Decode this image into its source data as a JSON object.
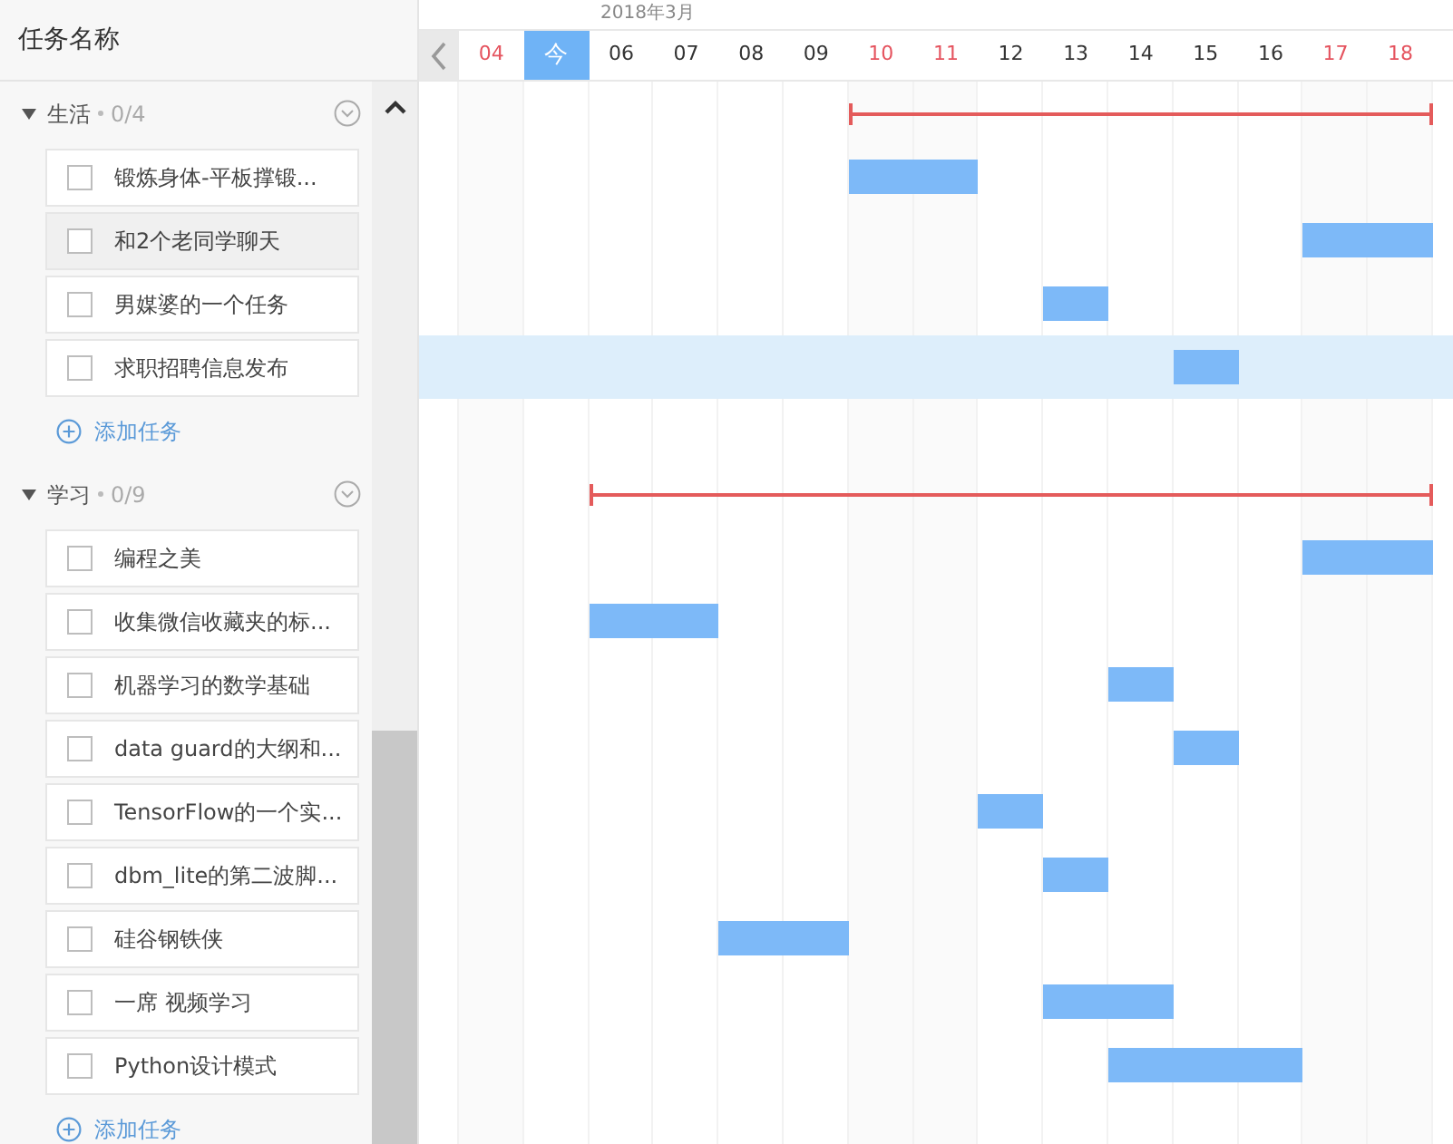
{
  "header": {
    "title": "任务名称"
  },
  "month": "2018年3月",
  "days": [
    {
      "label": "04",
      "weekend": true,
      "today": false
    },
    {
      "label": "今",
      "weekend": false,
      "today": true
    },
    {
      "label": "06",
      "weekend": false,
      "today": false
    },
    {
      "label": "07",
      "weekend": false,
      "today": false
    },
    {
      "label": "08",
      "weekend": false,
      "today": false
    },
    {
      "label": "09",
      "weekend": false,
      "today": false
    },
    {
      "label": "10",
      "weekend": true,
      "today": false
    },
    {
      "label": "11",
      "weekend": true,
      "today": false
    },
    {
      "label": "12",
      "weekend": false,
      "today": false
    },
    {
      "label": "13",
      "weekend": false,
      "today": false
    },
    {
      "label": "14",
      "weekend": false,
      "today": false
    },
    {
      "label": "15",
      "weekend": false,
      "today": false
    },
    {
      "label": "16",
      "weekend": false,
      "today": false
    },
    {
      "label": "17",
      "weekend": true,
      "today": false
    },
    {
      "label": "18",
      "weekend": true,
      "today": false
    }
  ],
  "groups": [
    {
      "name": "生活",
      "count": "0/4",
      "expanded": true,
      "span_days": [
        false,
        false,
        false,
        false,
        false,
        false,
        true,
        true,
        true,
        true,
        true,
        true,
        true,
        true,
        true
      ],
      "add_label": "添加任务",
      "tasks": [
        {
          "name": "锻炼身体-平板撑锻...",
          "checked": false,
          "hovered": false,
          "selected": false,
          "bar_days": [
            false,
            false,
            false,
            false,
            false,
            false,
            true,
            true,
            false,
            false,
            false,
            false,
            false,
            false,
            false
          ]
        },
        {
          "name": "和2个老同学聊天",
          "checked": false,
          "hovered": true,
          "selected": false,
          "bar_days": [
            false,
            false,
            false,
            false,
            false,
            false,
            false,
            false,
            false,
            false,
            false,
            false,
            false,
            true,
            true
          ]
        },
        {
          "name": "男媒婆的一个任务",
          "checked": false,
          "hovered": false,
          "selected": false,
          "bar_days": [
            false,
            false,
            false,
            false,
            false,
            false,
            false,
            false,
            false,
            true,
            false,
            false,
            false,
            false,
            false
          ]
        },
        {
          "name": "求职招聘信息发布",
          "checked": false,
          "hovered": false,
          "selected": true,
          "bar_days": [
            false,
            false,
            false,
            false,
            false,
            false,
            false,
            false,
            false,
            false,
            false,
            true,
            false,
            false,
            false
          ]
        }
      ]
    },
    {
      "name": "学习",
      "count": "0/9",
      "expanded": true,
      "span_days": [
        false,
        false,
        true,
        true,
        true,
        true,
        true,
        true,
        true,
        true,
        true,
        true,
        true,
        true,
        true
      ],
      "add_label": "添加任务",
      "tasks": [
        {
          "name": "编程之美",
          "checked": false,
          "hovered": false,
          "selected": false,
          "bar_days": [
            false,
            false,
            false,
            false,
            false,
            false,
            false,
            false,
            false,
            false,
            false,
            false,
            false,
            true,
            true
          ]
        },
        {
          "name": "收集微信收藏夹的标...",
          "checked": false,
          "hovered": false,
          "selected": false,
          "bar_days": [
            false,
            false,
            true,
            true,
            false,
            false,
            false,
            false,
            false,
            false,
            false,
            false,
            false,
            false,
            false
          ]
        },
        {
          "name": "机器学习的数学基础",
          "checked": false,
          "hovered": false,
          "selected": false,
          "bar_days": [
            false,
            false,
            false,
            false,
            false,
            false,
            false,
            false,
            false,
            false,
            true,
            false,
            false,
            false,
            false
          ]
        },
        {
          "name": "data guard的大纲和...",
          "checked": false,
          "hovered": false,
          "selected": false,
          "bar_days": [
            false,
            false,
            false,
            false,
            false,
            false,
            false,
            false,
            false,
            false,
            false,
            true,
            false,
            false,
            false
          ]
        },
        {
          "name": "TensorFlow的一个实...",
          "checked": false,
          "hovered": false,
          "selected": false,
          "bar_days": [
            false,
            false,
            false,
            false,
            false,
            false,
            false,
            false,
            true,
            false,
            false,
            false,
            false,
            false,
            false
          ]
        },
        {
          "name": "dbm_lite的第二波脚...",
          "checked": false,
          "hovered": false,
          "selected": false,
          "bar_days": [
            false,
            false,
            false,
            false,
            false,
            false,
            false,
            false,
            false,
            true,
            false,
            false,
            false,
            false,
            false
          ]
        },
        {
          "name": "硅谷钢铁侠",
          "checked": false,
          "hovered": false,
          "selected": false,
          "bar_days": [
            false,
            false,
            false,
            false,
            true,
            true,
            false,
            false,
            false,
            false,
            false,
            false,
            false,
            false,
            false
          ]
        },
        {
          "name": "一席 视频学习",
          "checked": false,
          "hovered": false,
          "selected": false,
          "bar_days": [
            false,
            false,
            false,
            false,
            false,
            false,
            false,
            false,
            false,
            true,
            true,
            false,
            false,
            false,
            false
          ]
        },
        {
          "name": "Python设计模式",
          "checked": false,
          "hovered": false,
          "selected": false,
          "bar_days": [
            false,
            false,
            false,
            false,
            false,
            false,
            false,
            false,
            false,
            false,
            true,
            true,
            true,
            false,
            false
          ]
        }
      ]
    }
  ]
}
